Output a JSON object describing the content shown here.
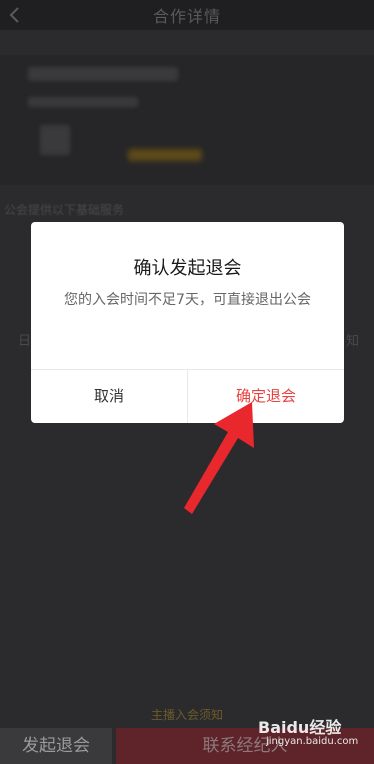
{
  "header": {
    "title": "合作详情"
  },
  "background": {
    "section_label": "公会提供以下基础服务",
    "left_fragment": "日",
    "right_fragment": "知"
  },
  "dialog": {
    "title": "确认发起退会",
    "message": "您的入会时间不足7天，可直接退出公会",
    "cancel_label": "取消",
    "confirm_label": "确定退会"
  },
  "footer": {
    "notice": "主播入会须知",
    "quit_label": "发起退会",
    "contact_label": "联系经纪人"
  },
  "watermark": {
    "logo_text": "Baidu经验",
    "url": "jingyan.baidu.com"
  },
  "colors": {
    "confirm": "#e64340",
    "overlay": "#2b2b2e",
    "arrow": "#e8282d"
  }
}
